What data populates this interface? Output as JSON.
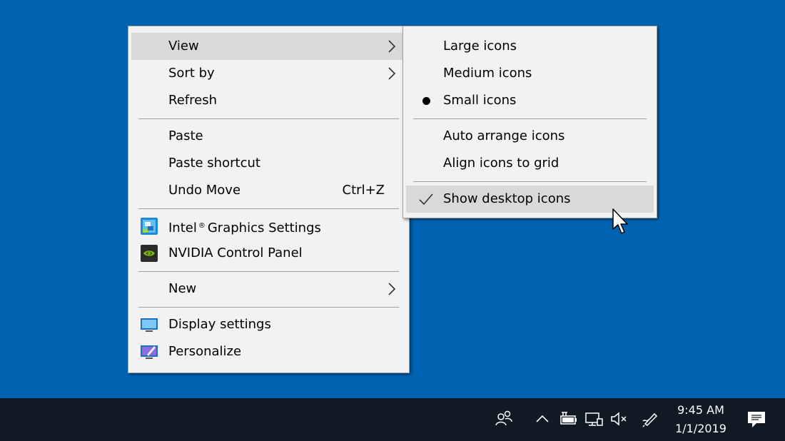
{
  "desktop": {
    "background_color": "#0063b1"
  },
  "context_menu": {
    "items": [
      {
        "label": "View",
        "has_submenu": true,
        "highlighted": true
      },
      {
        "label": "Sort by",
        "has_submenu": true
      },
      {
        "label": "Refresh"
      },
      {
        "separator": true
      },
      {
        "label": "Paste"
      },
      {
        "label": "Paste shortcut"
      },
      {
        "label": "Undo Move",
        "shortcut": "Ctrl+Z"
      },
      {
        "separator": true
      },
      {
        "label": "Intel",
        "label_suffix": "Graphics Settings",
        "registered_mark": "®",
        "icon": "intel-graphics-icon"
      },
      {
        "label": "NVIDIA Control Panel",
        "icon": "nvidia-icon"
      },
      {
        "separator": true
      },
      {
        "label": "New",
        "has_submenu": true
      },
      {
        "separator": true
      },
      {
        "label": "Display settings",
        "icon": "display-icon"
      },
      {
        "label": "Personalize",
        "icon": "personalize-icon"
      }
    ]
  },
  "view_submenu": {
    "items": [
      {
        "label": "Large icons"
      },
      {
        "label": "Medium icons"
      },
      {
        "label": "Small icons",
        "selected_radio": true
      },
      {
        "separator": true
      },
      {
        "label": "Auto arrange icons"
      },
      {
        "label": "Align icons to grid"
      },
      {
        "separator": true
      },
      {
        "label": "Show desktop icons",
        "checked": true,
        "highlighted": true
      }
    ]
  },
  "taskbar": {
    "tray_icons": [
      "people-icon",
      "chevron-up-icon",
      "battery-charging-icon",
      "network-icon",
      "volume-muted-icon",
      "pen-icon"
    ],
    "clock": {
      "time": "9:45 AM",
      "date": "1/1/2019"
    },
    "notification_icon": "action-center-icon"
  }
}
